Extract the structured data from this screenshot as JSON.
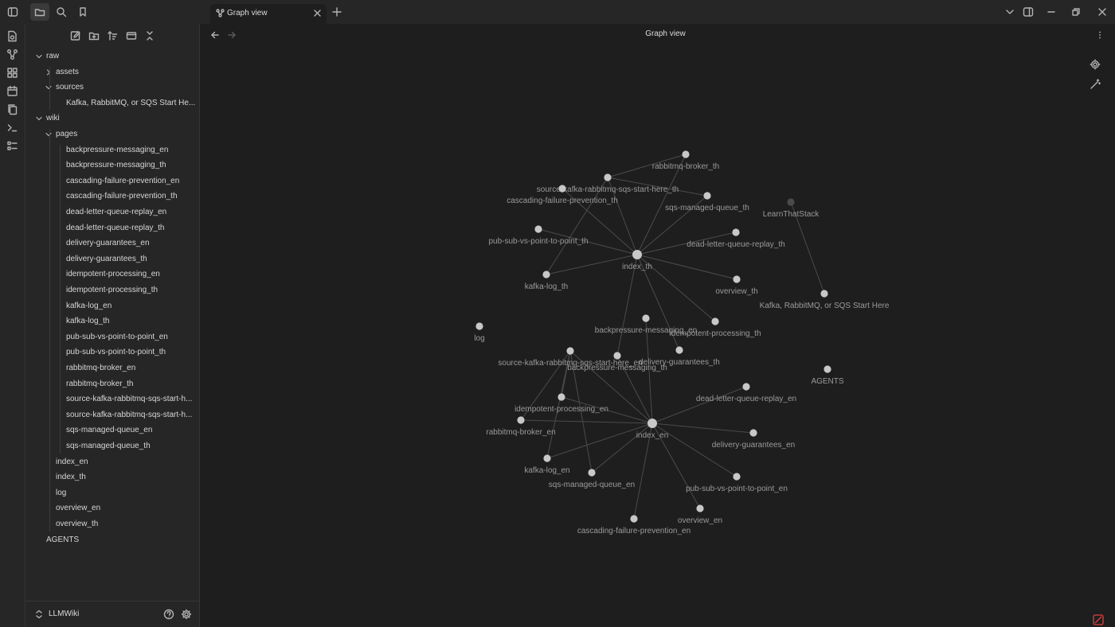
{
  "tab": {
    "title": "Graph view"
  },
  "view": {
    "title": "Graph view"
  },
  "vault": {
    "name": "LLMWiki"
  },
  "icons": {
    "sidebar_toggle": "sidebar-left-icon",
    "files": "folder-icon",
    "search": "search-icon",
    "bookmarks": "bookmark-icon",
    "new_note": "edit-icon",
    "new_folder": "folder-plus-icon",
    "sort": "sort-icon",
    "auto_reveal": "reveal-icon",
    "collapse": "collapse-icon",
    "graph_settings": "gear-icon",
    "animate": "magic-wand-icon"
  },
  "colors": {
    "node": "#c8c8c8",
    "node_dim": "#4a4a4a",
    "edge": "#4b4b4b",
    "warning": "#e04040"
  },
  "tree": [
    {
      "label": "raw",
      "level": 0,
      "arrow": "down"
    },
    {
      "label": "assets",
      "level": 1,
      "arrow": "right"
    },
    {
      "label": "sources",
      "level": 1,
      "arrow": "down"
    },
    {
      "label": "Kafka, RabbitMQ, or SQS Start He...",
      "level": 2,
      "arrow": ""
    },
    {
      "label": "wiki",
      "level": 0,
      "arrow": "down"
    },
    {
      "label": "pages",
      "level": 1,
      "arrow": "down"
    },
    {
      "label": "backpressure-messaging_en",
      "level": 2,
      "arrow": ""
    },
    {
      "label": "backpressure-messaging_th",
      "level": 2,
      "arrow": ""
    },
    {
      "label": "cascading-failure-prevention_en",
      "level": 2,
      "arrow": ""
    },
    {
      "label": "cascading-failure-prevention_th",
      "level": 2,
      "arrow": ""
    },
    {
      "label": "dead-letter-queue-replay_en",
      "level": 2,
      "arrow": ""
    },
    {
      "label": "dead-letter-queue-replay_th",
      "level": 2,
      "arrow": ""
    },
    {
      "label": "delivery-guarantees_en",
      "level": 2,
      "arrow": ""
    },
    {
      "label": "delivery-guarantees_th",
      "level": 2,
      "arrow": ""
    },
    {
      "label": "idempotent-processing_en",
      "level": 2,
      "arrow": ""
    },
    {
      "label": "idempotent-processing_th",
      "level": 2,
      "arrow": ""
    },
    {
      "label": "kafka-log_en",
      "level": 2,
      "arrow": ""
    },
    {
      "label": "kafka-log_th",
      "level": 2,
      "arrow": ""
    },
    {
      "label": "pub-sub-vs-point-to-point_en",
      "level": 2,
      "arrow": ""
    },
    {
      "label": "pub-sub-vs-point-to-point_th",
      "level": 2,
      "arrow": ""
    },
    {
      "label": "rabbitmq-broker_en",
      "level": 2,
      "arrow": ""
    },
    {
      "label": "rabbitmq-broker_th",
      "level": 2,
      "arrow": ""
    },
    {
      "label": "source-kafka-rabbitmq-sqs-start-h...",
      "level": 2,
      "arrow": ""
    },
    {
      "label": "source-kafka-rabbitmq-sqs-start-h...",
      "level": 2,
      "arrow": ""
    },
    {
      "label": "sqs-managed-queue_en",
      "level": 2,
      "arrow": ""
    },
    {
      "label": "sqs-managed-queue_th",
      "level": 2,
      "arrow": ""
    },
    {
      "label": "index_en",
      "level": 1,
      "arrow": ""
    },
    {
      "label": "index_th",
      "level": 1,
      "arrow": ""
    },
    {
      "label": "log",
      "level": 1,
      "arrow": ""
    },
    {
      "label": "overview_en",
      "level": 1,
      "arrow": ""
    },
    {
      "label": "overview_th",
      "level": 1,
      "arrow": ""
    },
    {
      "label": "AGENTS",
      "level": 0,
      "arrow": ""
    }
  ],
  "graph": {
    "nodes": [
      {
        "id": "rbth",
        "label": "rabbitmq-broker_th"
      },
      {
        "id": "srcth",
        "label": "source-kafka-rabbitmq-sqs-start-here_th"
      },
      {
        "id": "cfth",
        "label": "cascading-failure-prevention_th"
      },
      {
        "id": "sqsth",
        "label": "sqs-managed-queue_th"
      },
      {
        "id": "lts",
        "label": "LearnThatStack",
        "dim": true
      },
      {
        "id": "psth",
        "label": "pub-sub-vs-point-to-point_th"
      },
      {
        "id": "dlqth",
        "label": "dead-letter-queue-replay_th"
      },
      {
        "id": "ith",
        "label": "index_th",
        "hub": true
      },
      {
        "id": "klth",
        "label": "kafka-log_th"
      },
      {
        "id": "ovth",
        "label": "overview_th"
      },
      {
        "id": "kafka",
        "label": "Kafka, RabbitMQ, or SQS Start Here"
      },
      {
        "id": "log",
        "label": "log"
      },
      {
        "id": "bpen",
        "label": "backpressure-messaging_en"
      },
      {
        "id": "ipth",
        "label": "idempotent-processing_th"
      },
      {
        "id": "srcen",
        "label": "source-kafka-rabbitmq-sqs-start-here_en"
      },
      {
        "id": "bpth",
        "label": "backpressure-messaging_th"
      },
      {
        "id": "dgth",
        "label": "delivery-guarantees_th"
      },
      {
        "id": "agents",
        "label": "AGENTS"
      },
      {
        "id": "dlqen",
        "label": "dead-letter-queue-replay_en"
      },
      {
        "id": "ipen",
        "label": "idempotent-processing_en"
      },
      {
        "id": "rben",
        "label": "rabbitmq-broker_en"
      },
      {
        "id": "ien",
        "label": "index_en",
        "hub": true
      },
      {
        "id": "dgen",
        "label": "delivery-guarantees_en"
      },
      {
        "id": "klen",
        "label": "kafka-log_en"
      },
      {
        "id": "sqsen",
        "label": "sqs-managed-queue_en"
      },
      {
        "id": "psen",
        "label": "pub-sub-vs-point-to-point_en"
      },
      {
        "id": "oven",
        "label": "overview_en"
      },
      {
        "id": "cfen",
        "label": "cascading-failure-prevention_en"
      }
    ],
    "edges": [
      [
        "ith",
        "rbth"
      ],
      [
        "ith",
        "srcth"
      ],
      [
        "ith",
        "cfth"
      ],
      [
        "ith",
        "sqsth"
      ],
      [
        "ith",
        "psth"
      ],
      [
        "ith",
        "dlqth"
      ],
      [
        "ith",
        "klth"
      ],
      [
        "ith",
        "ovth"
      ],
      [
        "ith",
        "ipth"
      ],
      [
        "ith",
        "bpth"
      ],
      [
        "ith",
        "dgth"
      ],
      [
        "srcth",
        "rbth"
      ],
      [
        "srcth",
        "sqsth"
      ],
      [
        "srcth",
        "klth"
      ],
      [
        "lts",
        "kafka"
      ],
      [
        "ien",
        "srcen"
      ],
      [
        "ien",
        "ipen"
      ],
      [
        "ien",
        "rben"
      ],
      [
        "ien",
        "klen"
      ],
      [
        "ien",
        "sqsen"
      ],
      [
        "ien",
        "cfen"
      ],
      [
        "ien",
        "oven"
      ],
      [
        "ien",
        "psen"
      ],
      [
        "ien",
        "dgen"
      ],
      [
        "ien",
        "dlqen"
      ],
      [
        "ien",
        "bpen"
      ],
      [
        "ien",
        "bpth"
      ],
      [
        "srcen",
        "ipen"
      ],
      [
        "srcen",
        "rben"
      ],
      [
        "srcen",
        "sqsen"
      ],
      [
        "srcen",
        "klen"
      ]
    ]
  }
}
